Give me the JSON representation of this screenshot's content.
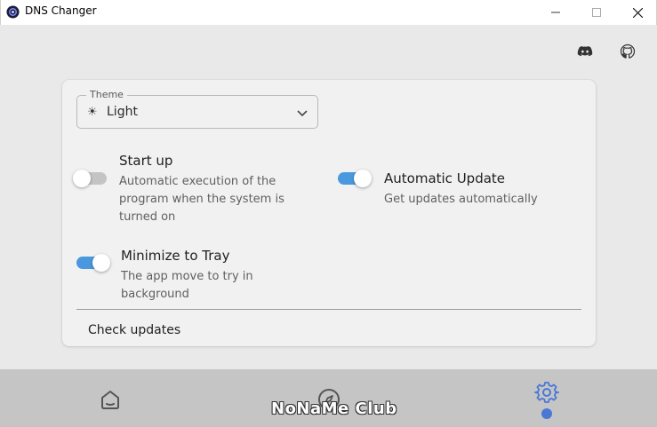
{
  "window": {
    "title": "DNS Changer",
    "icons": {
      "app": "dns-changer-app-icon",
      "minimize": "minimize-icon",
      "maximize": "maximize-icon",
      "close": "close-icon"
    }
  },
  "header": {
    "icons": [
      "discord-icon",
      "github-icon"
    ]
  },
  "settings": {
    "theme": {
      "label": "Theme",
      "value": "Light",
      "icon": "sun-icon"
    },
    "startup": {
      "title": "Start up",
      "description": "Automatic execution of the program when the system is turned on",
      "enabled": false
    },
    "auto_update": {
      "title": "Automatic Update",
      "description": "Get updates automatically",
      "enabled": true
    },
    "minimize_tray": {
      "title": "Minimize to Tray",
      "description": "The app move to try in background",
      "enabled": true
    },
    "check_updates_label": "Check updates"
  },
  "bottom_nav": {
    "items": [
      {
        "icon": "home-icon",
        "active": false
      },
      {
        "icon": "compass-icon",
        "active": false
      },
      {
        "icon": "settings-gear-icon",
        "active": true
      }
    ],
    "watermark": "NoNaMe Club"
  },
  "colors": {
    "accent": "#4a98de",
    "active_nav": "#4a78d6",
    "card_bg": "#f1f1f1",
    "bottom_bar": "#c5c5c5"
  }
}
